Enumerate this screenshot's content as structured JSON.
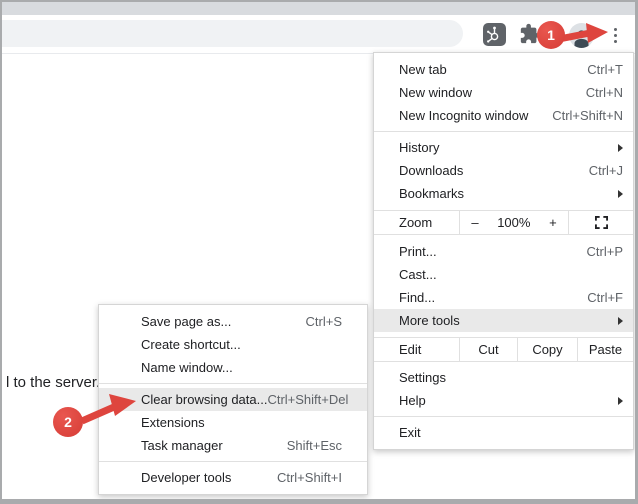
{
  "page": {
    "text": "l to the server."
  },
  "toolbar": {
    "icons": {
      "hub_badge": "sprocket-badge-icon",
      "extensions": "puzzle-icon",
      "profile": "avatar-icon",
      "menu": "kebab-menu-icon"
    }
  },
  "annotations": {
    "badge1": "1",
    "badge2": "2",
    "accent_color": "#de453e"
  },
  "main_menu": {
    "section1": [
      {
        "label": "New tab",
        "shortcut": "Ctrl+T"
      },
      {
        "label": "New window",
        "shortcut": "Ctrl+N"
      },
      {
        "label": "New Incognito window",
        "shortcut": "Ctrl+Shift+N"
      }
    ],
    "section2": [
      {
        "label": "History"
      },
      {
        "label": "Downloads",
        "shortcut": "Ctrl+J"
      },
      {
        "label": "Bookmarks"
      }
    ],
    "zoom_row": {
      "label": "Zoom",
      "minus": "–",
      "value": "100%",
      "plus": "+"
    },
    "section3": [
      {
        "label": "Print...",
        "shortcut": "Ctrl+P"
      },
      {
        "label": "Cast..."
      },
      {
        "label": "Find...",
        "shortcut": "Ctrl+F"
      },
      {
        "label": "More tools"
      }
    ],
    "edit_row": {
      "label": "Edit",
      "cut": "Cut",
      "copy": "Copy",
      "paste": "Paste"
    },
    "section4": [
      {
        "label": "Settings"
      },
      {
        "label": "Help"
      }
    ],
    "section5": [
      {
        "label": "Exit"
      }
    ]
  },
  "submenu": {
    "section1": [
      {
        "label": "Save page as...",
        "shortcut": "Ctrl+S"
      },
      {
        "label": "Create shortcut..."
      },
      {
        "label": "Name window..."
      }
    ],
    "section2": [
      {
        "label": "Clear browsing data...",
        "shortcut": "Ctrl+Shift+Del"
      },
      {
        "label": "Extensions"
      },
      {
        "label": "Task manager",
        "shortcut": "Shift+Esc"
      }
    ],
    "section3": [
      {
        "label": "Developer tools",
        "shortcut": "Ctrl+Shift+I"
      }
    ]
  },
  "colors": {
    "highlight": "#e9e9e9",
    "menu_text": "#202124",
    "shortcut_text": "#5f6368",
    "tabstrip": "#d8dbdf",
    "omnibox": "#f0f2f4",
    "icon": "#5f6368"
  }
}
